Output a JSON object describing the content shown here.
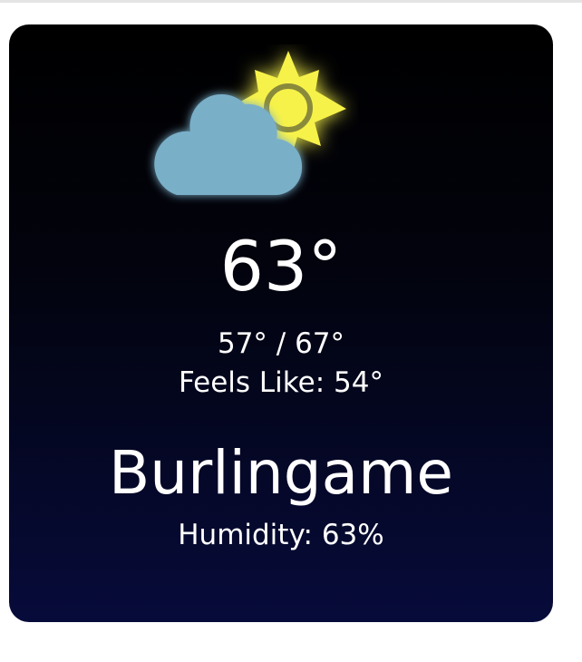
{
  "weather": {
    "temperature": "63°",
    "range": "57° / 67°",
    "feels_like": "Feels Like: 54°",
    "city": "Burlingame",
    "humidity": "Humidity: 63%",
    "icon": "partly-cloudy-day-icon"
  },
  "colors": {
    "card_top": "#000000",
    "card_bottom": "#070b3a",
    "cloud": "#7aafc8",
    "sun": "#f7f24a",
    "sun_ring": "#8a8a3a",
    "text": "#ffffff"
  }
}
